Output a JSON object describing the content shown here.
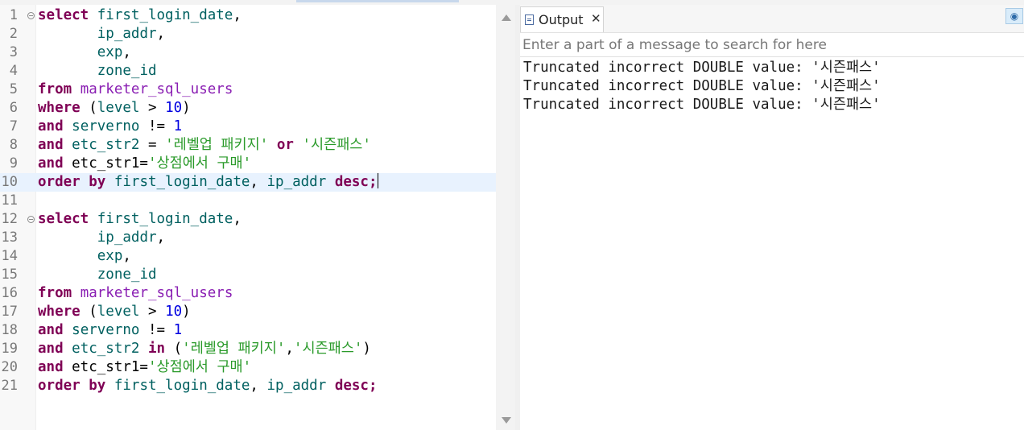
{
  "editor": {
    "lines": [
      {
        "n": "1",
        "fold": true,
        "tokens": [
          {
            "t": "select",
            "c": "kw"
          },
          {
            "t": " "
          },
          {
            "t": "first_login_date",
            "c": "id"
          },
          {
            "t": ","
          }
        ]
      },
      {
        "n": "2",
        "tokens": [
          {
            "t": "       "
          },
          {
            "t": "ip_addr",
            "c": "id"
          },
          {
            "t": ","
          }
        ]
      },
      {
        "n": "3",
        "tokens": [
          {
            "t": "       "
          },
          {
            "t": "exp",
            "c": "id"
          },
          {
            "t": ","
          }
        ]
      },
      {
        "n": "4",
        "tokens": [
          {
            "t": "       "
          },
          {
            "t": "zone_id",
            "c": "id"
          }
        ]
      },
      {
        "n": "5",
        "tokens": [
          {
            "t": "from",
            "c": "kw"
          },
          {
            "t": " "
          },
          {
            "t": "marketer_sql_users",
            "c": "tb"
          }
        ]
      },
      {
        "n": "6",
        "tokens": [
          {
            "t": "where",
            "c": "kw"
          },
          {
            "t": " ("
          },
          {
            "t": "level",
            "c": "id"
          },
          {
            "t": " > "
          },
          {
            "t": "10",
            "c": "num"
          },
          {
            "t": ")"
          }
        ]
      },
      {
        "n": "7",
        "tokens": [
          {
            "t": "and",
            "c": "kw"
          },
          {
            "t": " "
          },
          {
            "t": "serverno",
            "c": "id"
          },
          {
            "t": " != "
          },
          {
            "t": "1",
            "c": "num"
          }
        ]
      },
      {
        "n": "8",
        "tokens": [
          {
            "t": "and",
            "c": "kw"
          },
          {
            "t": " "
          },
          {
            "t": "etc_str2",
            "c": "id"
          },
          {
            "t": " = "
          },
          {
            "t": "'레벨업 패키지'",
            "c": "str"
          },
          {
            "t": " "
          },
          {
            "t": "or",
            "c": "kw"
          },
          {
            "t": " "
          },
          {
            "t": "'시즌패스'",
            "c": "str"
          }
        ]
      },
      {
        "n": "9",
        "tokens": [
          {
            "t": "and",
            "c": "kw"
          },
          {
            "t": " etc_str1="
          },
          {
            "t": "'상점에서 구매'",
            "c": "str"
          }
        ]
      },
      {
        "n": "10",
        "current": true,
        "cursor": true,
        "tokens": [
          {
            "t": "order by",
            "c": "kw"
          },
          {
            "t": " "
          },
          {
            "t": "first_login_date",
            "c": "id"
          },
          {
            "t": ", "
          },
          {
            "t": "ip_addr",
            "c": "id"
          },
          {
            "t": " "
          },
          {
            "t": "desc",
            "c": "kw"
          },
          {
            "t": ";",
            "c": "kw"
          }
        ]
      },
      {
        "n": "11",
        "tokens": []
      },
      {
        "n": "12",
        "fold": true,
        "tokens": [
          {
            "t": "select",
            "c": "kw"
          },
          {
            "t": " "
          },
          {
            "t": "first_login_date",
            "c": "id"
          },
          {
            "t": ","
          }
        ]
      },
      {
        "n": "13",
        "tokens": [
          {
            "t": "       "
          },
          {
            "t": "ip_addr",
            "c": "id"
          },
          {
            "t": ","
          }
        ]
      },
      {
        "n": "14",
        "tokens": [
          {
            "t": "       "
          },
          {
            "t": "exp",
            "c": "id"
          },
          {
            "t": ","
          }
        ]
      },
      {
        "n": "15",
        "tokens": [
          {
            "t": "       "
          },
          {
            "t": "zone_id",
            "c": "id"
          }
        ]
      },
      {
        "n": "16",
        "tokens": [
          {
            "t": "from",
            "c": "kw"
          },
          {
            "t": " "
          },
          {
            "t": "marketer_sql_users",
            "c": "tb"
          }
        ]
      },
      {
        "n": "17",
        "tokens": [
          {
            "t": "where",
            "c": "kw"
          },
          {
            "t": " ("
          },
          {
            "t": "level",
            "c": "id"
          },
          {
            "t": " > "
          },
          {
            "t": "10",
            "c": "num"
          },
          {
            "t": ")"
          }
        ]
      },
      {
        "n": "18",
        "tokens": [
          {
            "t": "and",
            "c": "kw"
          },
          {
            "t": " "
          },
          {
            "t": "serverno",
            "c": "id"
          },
          {
            "t": " != "
          },
          {
            "t": "1",
            "c": "num"
          }
        ]
      },
      {
        "n": "19",
        "tokens": [
          {
            "t": "and",
            "c": "kw"
          },
          {
            "t": " "
          },
          {
            "t": "etc_str2",
            "c": "id"
          },
          {
            "t": " "
          },
          {
            "t": "in",
            "c": "kw"
          },
          {
            "t": " ("
          },
          {
            "t": "'레벨업 패키지'",
            "c": "str"
          },
          {
            "t": ","
          },
          {
            "t": "'시즌패스'",
            "c": "str"
          },
          {
            "t": ")"
          }
        ]
      },
      {
        "n": "20",
        "tokens": [
          {
            "t": "and",
            "c": "kw"
          },
          {
            "t": " etc_str1="
          },
          {
            "t": "'상점에서 구매'",
            "c": "str"
          }
        ]
      },
      {
        "n": "21",
        "tokens": [
          {
            "t": "order by",
            "c": "kw"
          },
          {
            "t": " "
          },
          {
            "t": "first_login_date",
            "c": "id"
          },
          {
            "t": ", "
          },
          {
            "t": "ip_addr",
            "c": "id"
          },
          {
            "t": " "
          },
          {
            "t": "desc",
            "c": "kw"
          },
          {
            "t": ";",
            "c": "kw"
          }
        ]
      }
    ]
  },
  "output": {
    "tab_label": "Output",
    "close_glyph": "✕",
    "view_glyph": "◉",
    "search_placeholder": "Enter a part of a message to search for here",
    "search_value": "",
    "messages": [
      "Truncated incorrect DOUBLE value: '시즌패스'",
      "Truncated incorrect DOUBLE value: '시즌패스'",
      "Truncated incorrect DOUBLE value: '시즌패스'"
    ]
  },
  "colors": {
    "keyword": "#7f0055",
    "identifier": "#006060",
    "table": "#8a1fb3",
    "number": "#0000e0",
    "string": "#2a9a2a",
    "current_line": "#e8f2fe"
  }
}
